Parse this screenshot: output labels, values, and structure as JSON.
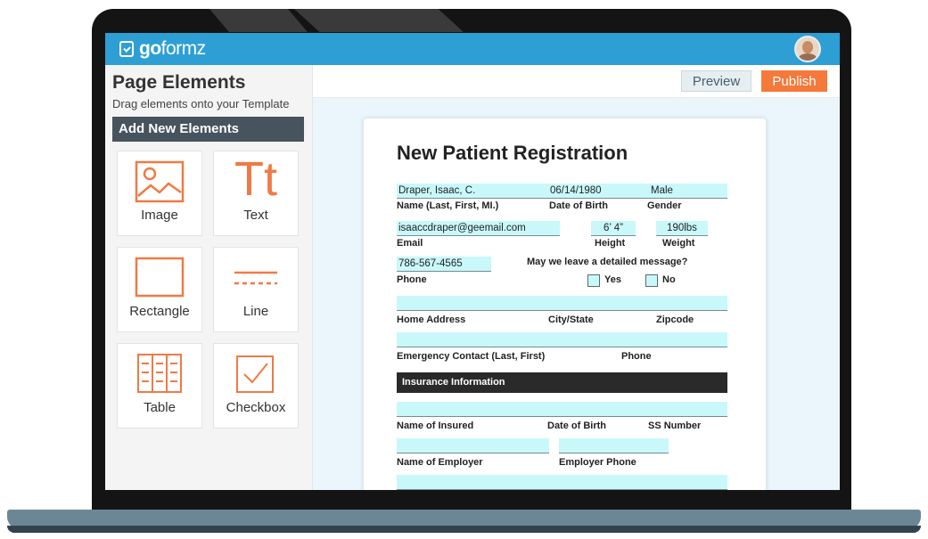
{
  "app": {
    "brand_prefix": "go",
    "brand_suffix": "formz"
  },
  "sidebar": {
    "title": "Page Elements",
    "subtitle": "Drag elements onto your Template",
    "section_title": "Add New Elements",
    "elements": [
      {
        "label": "Image",
        "icon": "image-icon"
      },
      {
        "label": "Text",
        "icon": "text-icon"
      },
      {
        "label": "Rectangle",
        "icon": "rectangle-icon"
      },
      {
        "label": "Line",
        "icon": "line-icon"
      },
      {
        "label": "Table",
        "icon": "table-icon"
      },
      {
        "label": "Checkbox",
        "icon": "checkbox-icon"
      }
    ],
    "text_icon_glyph": "Tt"
  },
  "toolbar": {
    "preview_label": "Preview",
    "publish_label": "Publish"
  },
  "colors": {
    "topbar": "#2d9fd4",
    "accent": "#f4793b",
    "field_fill": "#c9f8fb",
    "section_bar": "#2a2a2a"
  },
  "form": {
    "title": "New Patient Registration",
    "fields": {
      "name_value": "Draper, Isaac, C.",
      "dob_value": "06/14/1980",
      "gender_value": "Male",
      "email_value": "isaaccdraper@geemail.com",
      "height_value": "6’ 4”",
      "weight_value": "190lbs",
      "phone_value": "786-567-4565"
    },
    "labels": {
      "name": "Name (Last, First, MI.)",
      "dob": "Date of Birth",
      "gender": "Gender",
      "email": "Email",
      "height": "Height",
      "weight": "Weight",
      "phone": "Phone",
      "message_question": "May we leave a detailed message?",
      "yes": "Yes",
      "no": "No",
      "home_address": "Home Address",
      "city_state": "City/State",
      "zipcode": "Zipcode",
      "emergency_contact": "Emergency Contact (Last, First)",
      "emergency_phone": "Phone",
      "insurance_section": "Insurance Information",
      "name_of_insured": "Name of Insured",
      "insured_dob": "Date of Birth",
      "ss_number": "SS Number",
      "name_of_employer": "Name of Employer",
      "employer_phone": "Employer Phone"
    }
  }
}
